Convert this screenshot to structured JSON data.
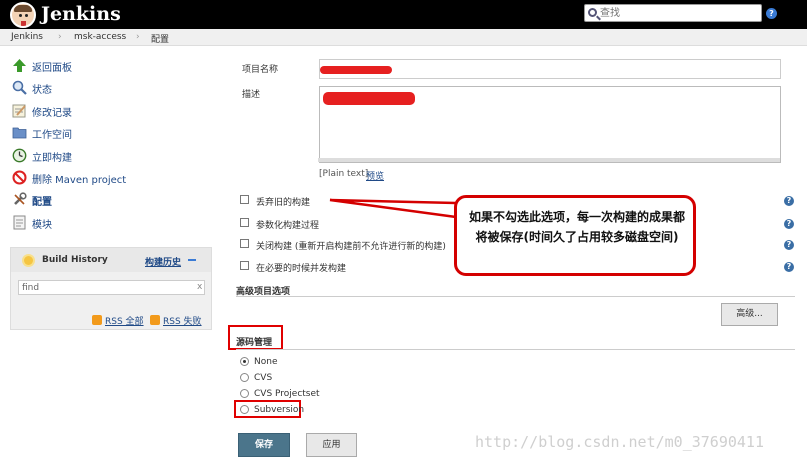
{
  "header": {
    "brand": "Jenkins",
    "search_placeholder": "查找",
    "help": "?"
  },
  "breadcrumb": {
    "items": [
      "Jenkins",
      "msk-access",
      "配置"
    ],
    "separator": "›"
  },
  "sidebar": {
    "items": [
      {
        "label": "返回面板",
        "icon": "up-arrow-icon"
      },
      {
        "label": "状态",
        "icon": "search-icon"
      },
      {
        "label": "修改记录",
        "icon": "notepad-icon"
      },
      {
        "label": "工作空间",
        "icon": "folder-icon"
      },
      {
        "label": "立即构建",
        "icon": "clock-icon"
      },
      {
        "label": "删除 Maven project",
        "icon": "no-entry-icon"
      },
      {
        "label": "配置",
        "icon": "wrench-icon"
      },
      {
        "label": "模块",
        "icon": "module-icon"
      }
    ]
  },
  "build_history": {
    "title": "Build History",
    "trend_link": "构建历史",
    "find_value": "find",
    "clear": "x",
    "rss_all": "RSS 全部",
    "rss_failed": "RSS 失败"
  },
  "form": {
    "name_label": "项目名称",
    "desc_label": "描述",
    "plain_text": "[Plain text]",
    "preview": "预览",
    "options": [
      "丢弃旧的构建",
      "参数化构建过程",
      "关闭构建 (重新开启构建前不允许进行新的构建)",
      "在必要的时候并发构建"
    ],
    "advanced_section": "高级项目选项",
    "advanced_button": "高级...",
    "scm_section": "源码管理",
    "scm_options": [
      {
        "label": "None",
        "selected": true
      },
      {
        "label": "CVS",
        "selected": false
      },
      {
        "label": "CVS Projectset",
        "selected": false
      },
      {
        "label": "Subversion",
        "selected": false
      }
    ],
    "save": "保存",
    "apply": "应用"
  },
  "annotation": {
    "text": "如果不勾选此选项，每一次构建的成果都将被保存(时间久了占用较多磁盘空间)"
  },
  "watermark": "http://blog.csdn.net/m0_37690411",
  "colors": {
    "topbar": "#000000",
    "link": "#204a87",
    "annotation": "#d40000",
    "save_button": "#4b758b"
  }
}
